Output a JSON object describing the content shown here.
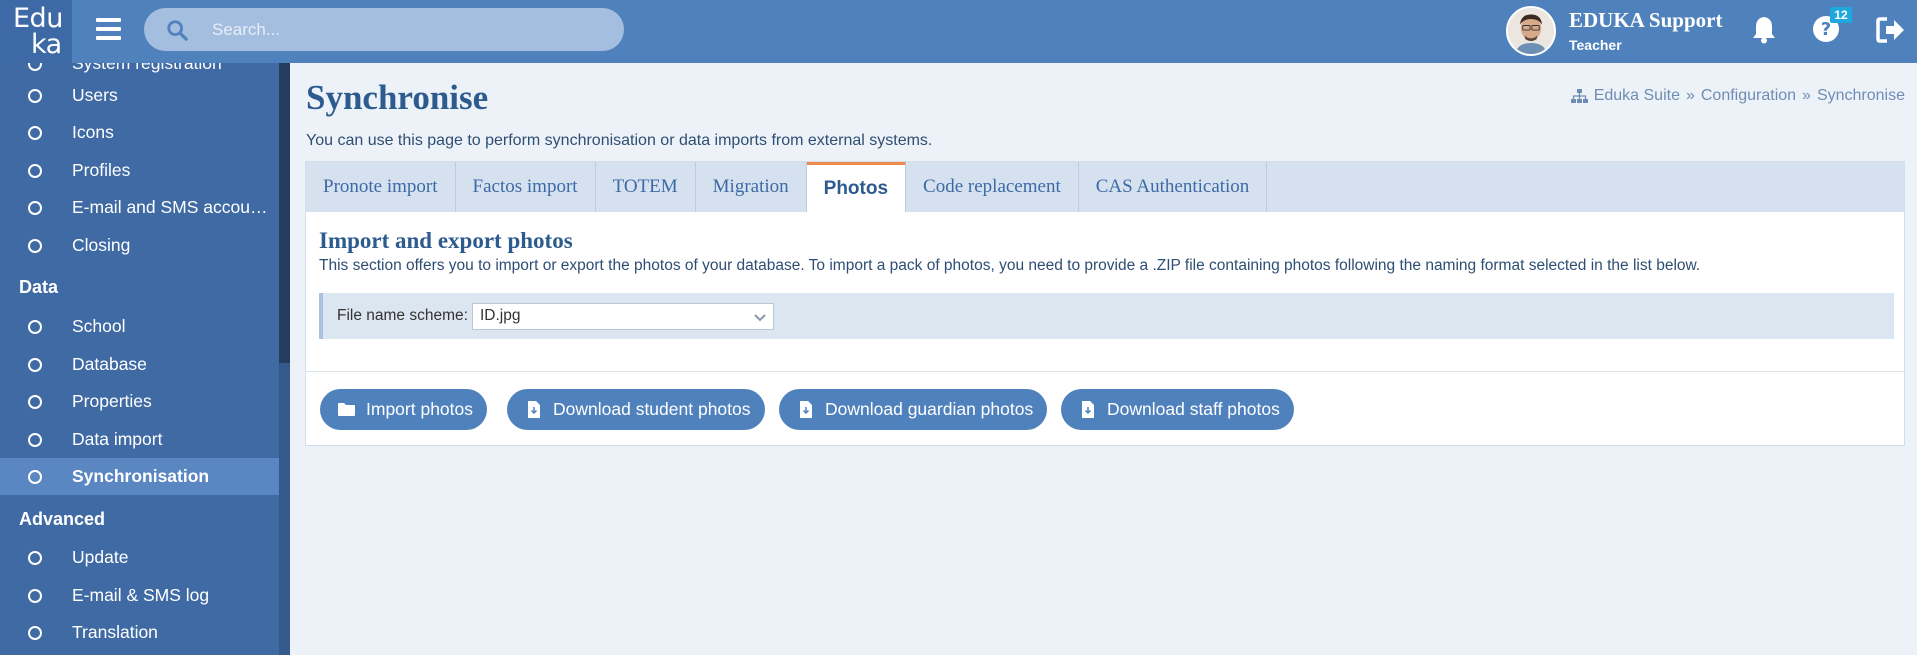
{
  "app": {
    "logo_line1": "Edu",
    "logo_line2": "ka",
    "search_placeholder": "Search...",
    "user_name": "EDUKA Support",
    "user_role": "Teacher",
    "help_badge": "12"
  },
  "sidebar": {
    "partial_top": "System registration",
    "group1": [
      {
        "label": "Users"
      },
      {
        "label": "Icons"
      },
      {
        "label": "Profiles"
      },
      {
        "label": "E-mail and SMS accounts"
      },
      {
        "label": "Closing"
      }
    ],
    "header_data": "Data",
    "group2": [
      {
        "label": "School"
      },
      {
        "label": "Database"
      },
      {
        "label": "Properties"
      },
      {
        "label": "Data import"
      },
      {
        "label": "Synchronisation",
        "active": true
      }
    ],
    "header_advanced": "Advanced",
    "group3": [
      {
        "label": "Update"
      },
      {
        "label": "E-mail & SMS log"
      },
      {
        "label": "Translation"
      }
    ]
  },
  "page": {
    "title": "Synchronise",
    "breadcrumb": [
      "Eduka Suite",
      "»",
      "Configuration",
      "»",
      "Synchronise"
    ],
    "subtitle": "You can use this page to perform synchronisation or data imports from external systems."
  },
  "tabs": [
    {
      "label": "Pronote import"
    },
    {
      "label": "Factos import"
    },
    {
      "label": "TOTEM"
    },
    {
      "label": "Migration"
    },
    {
      "label": "Photos",
      "active": true
    },
    {
      "label": "Code replacement"
    },
    {
      "label": "CAS Authentication"
    }
  ],
  "photos": {
    "title": "Import and export photos",
    "description": "This section offers you to import or export the photos of your database. To import a pack of photos, you need to provide a .ZIP file containing photos following the naming format selected in the list below.",
    "scheme_label": "File name scheme:",
    "scheme_value": "ID.jpg",
    "buttons": {
      "import": "Import photos",
      "students": "Download student photos",
      "guardians": "Download guardian photos",
      "staff": "Download staff photos"
    }
  },
  "colors": {
    "topbar": "#4f81bd",
    "sidebar": "#3f6aa4",
    "accent_tab": "#ed8a4f",
    "title": "#2d5b8e",
    "badge": "#1fa8dd"
  }
}
